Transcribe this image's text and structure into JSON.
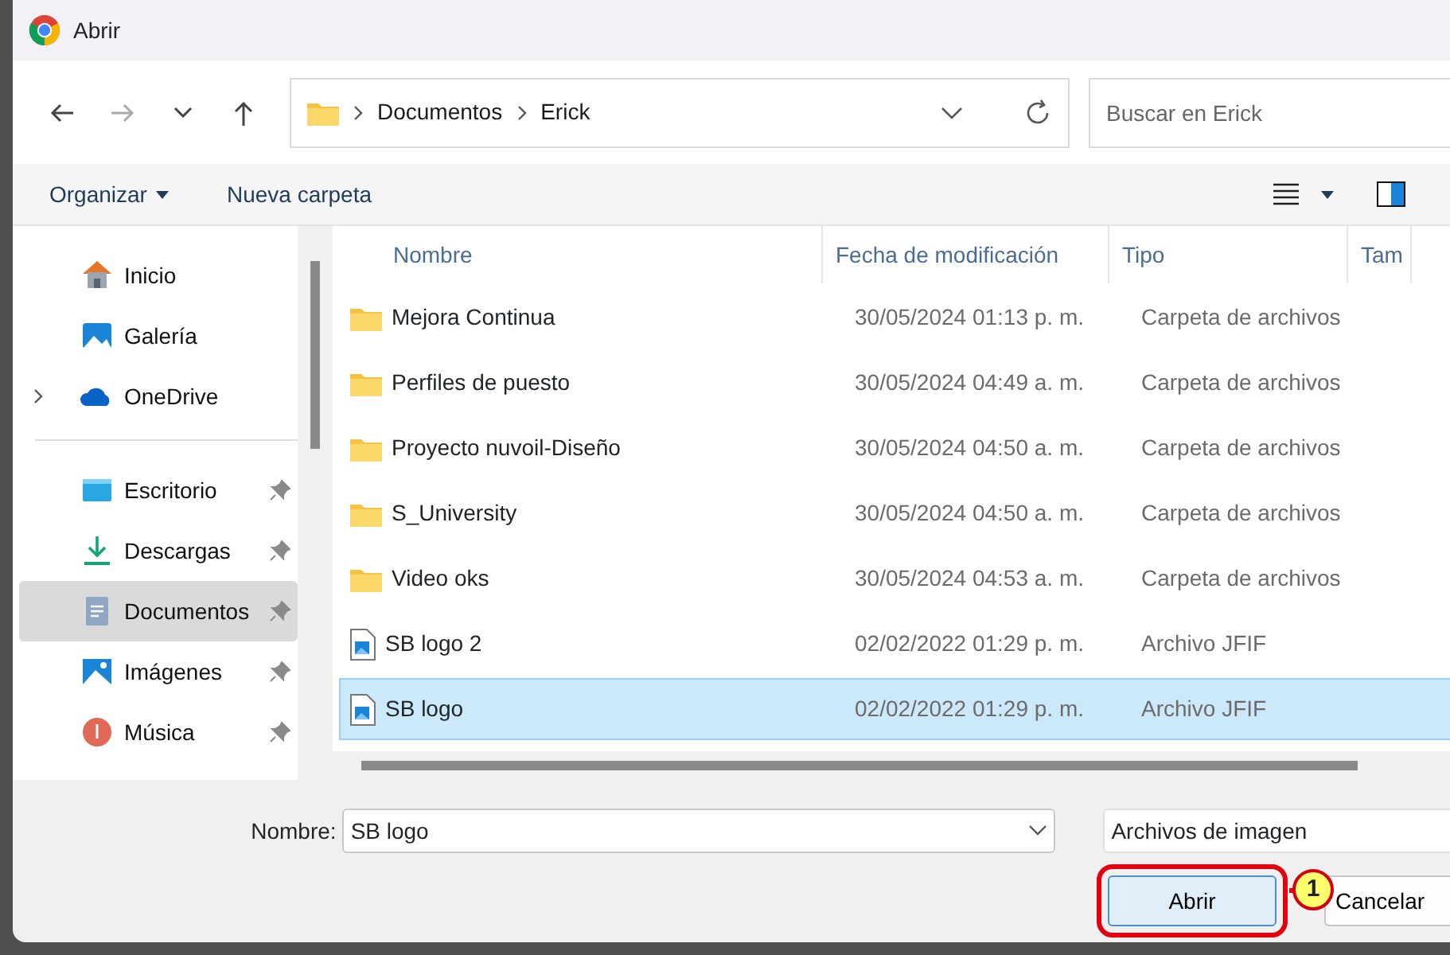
{
  "window": {
    "title": "Abrir"
  },
  "breadcrumb": [
    "Documentos",
    "Erick"
  ],
  "search": {
    "placeholder": "Buscar en Erick"
  },
  "toolbar": {
    "organize": "Organizar",
    "new_folder": "Nueva carpeta"
  },
  "sidebar": {
    "items": [
      {
        "label": "Inicio",
        "kind": "home",
        "pinned": false,
        "selected": false,
        "expandable": false
      },
      {
        "label": "Galería",
        "kind": "gallery",
        "pinned": false,
        "selected": false,
        "expandable": false
      },
      {
        "label": "OneDrive",
        "kind": "cloud",
        "pinned": false,
        "selected": false,
        "expandable": true
      },
      {
        "label": "Escritorio",
        "kind": "desktop",
        "pinned": true,
        "selected": false,
        "expandable": false
      },
      {
        "label": "Descargas",
        "kind": "download",
        "pinned": true,
        "selected": false,
        "expandable": false
      },
      {
        "label": "Documentos",
        "kind": "document",
        "pinned": true,
        "selected": true,
        "expandable": false
      },
      {
        "label": "Imágenes",
        "kind": "pictures",
        "pinned": true,
        "selected": false,
        "expandable": false
      },
      {
        "label": "Música",
        "kind": "music",
        "pinned": true,
        "selected": false,
        "expandable": false
      }
    ]
  },
  "table": {
    "columns": [
      "Nombre",
      "Fecha de modificación",
      "Tipo",
      "Tam"
    ],
    "rows": [
      {
        "name": "Mejora Continua",
        "date": "30/05/2024 01:13 p. m.",
        "type": "Carpeta de archivos",
        "kind": "folder",
        "selected": false
      },
      {
        "name": "Perfiles de puesto",
        "date": "30/05/2024 04:49 a. m.",
        "type": "Carpeta de archivos",
        "kind": "folder",
        "selected": false
      },
      {
        "name": "Proyecto nuvoil-Diseño",
        "date": "30/05/2024 04:50 a. m.",
        "type": "Carpeta de archivos",
        "kind": "folder",
        "selected": false
      },
      {
        "name": "S_University",
        "date": "30/05/2024 04:50 a. m.",
        "type": "Carpeta de archivos",
        "kind": "folder",
        "selected": false
      },
      {
        "name": "Video oks",
        "date": "30/05/2024 04:53 a. m.",
        "type": "Carpeta de archivos",
        "kind": "folder",
        "selected": false
      },
      {
        "name": "SB logo 2",
        "date": "02/02/2022 01:29 p. m.",
        "type": "Archivo JFIF",
        "kind": "image",
        "selected": false
      },
      {
        "name": "SB logo",
        "date": "02/02/2022 01:29 p. m.",
        "type": "Archivo JFIF",
        "kind": "image",
        "selected": true
      }
    ]
  },
  "footer": {
    "name_label": "Nombre:",
    "name_value": "SB logo",
    "filter": "Archivos de imagen",
    "buttons": [
      {
        "label": "Abrir",
        "highlighted": true
      },
      {
        "label": "Cancelar",
        "highlighted": false
      }
    ]
  },
  "annotation": {
    "label": "1"
  }
}
